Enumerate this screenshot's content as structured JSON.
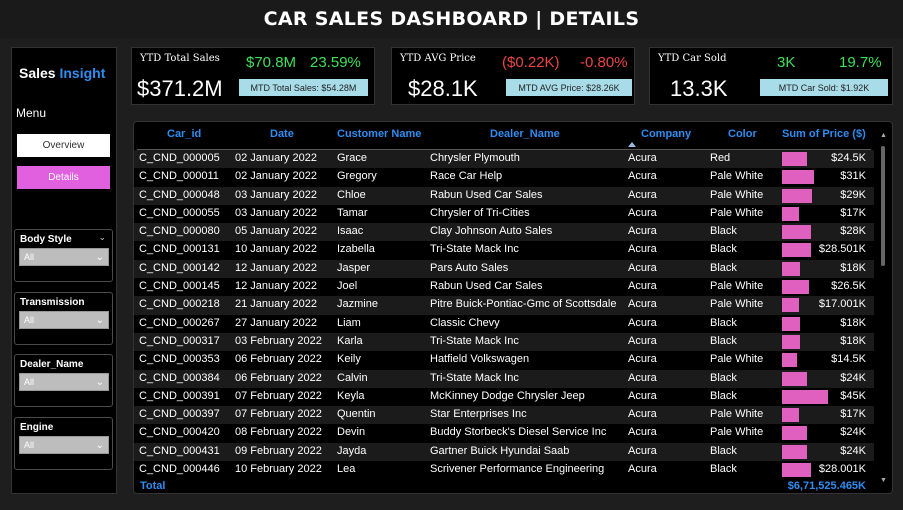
{
  "header": {
    "title": "CAR SALES DASHBOARD | DETAILS"
  },
  "sidebar": {
    "brand_part1": "Sales",
    "brand_part2": "Insight",
    "menu_label": "Menu",
    "overview_label": "Overview",
    "details_label": "Details",
    "slicers": [
      {
        "label": "Body Style",
        "value": "All"
      },
      {
        "label": "Transmission",
        "value": "All"
      },
      {
        "label": "Dealer_Name",
        "value": "All"
      },
      {
        "label": "Engine",
        "value": "All"
      }
    ]
  },
  "kpis": {
    "total_sales": {
      "title": "YTD Total Sales",
      "main": "$371.2M",
      "value": "$70.8M",
      "pct": "23.59%",
      "badge": "MTD Total Sales: $54.28M"
    },
    "avg_price": {
      "title": "YTD AVG Price",
      "main": "$28.1K",
      "value": "($0.22K)",
      "pct": "-0.80%",
      "badge": "MTD AVG Price: $28.26K"
    },
    "cars_sold": {
      "title": "YTD Car Sold",
      "main": "13.3K",
      "value": "3K",
      "pct": "19.7%",
      "badge": "MTD Car Sold: $1.92K"
    }
  },
  "colors": {
    "accent_blue": "#2f8cf0",
    "pink": "#e060c0",
    "positive": "#3fe05a",
    "negative": "#e84545",
    "badge_bg": "#a8dce8"
  },
  "table": {
    "headers": [
      "Car_id",
      "Date",
      "Customer Name",
      "Dealer_Name",
      "Company",
      "Color",
      "Sum of Price ($)"
    ],
    "rows": [
      {
        "car_id": "C_CND_000005",
        "date": "02 January 2022",
        "customer": "Grace",
        "dealer": "Chrysler Plymouth",
        "company": "Acura",
        "color": "Red",
        "price": "$24.5K",
        "price_value": 24500
      },
      {
        "car_id": "C_CND_000011",
        "date": "02 January 2022",
        "customer": "Gregory",
        "dealer": "Race Car Help",
        "company": "Acura",
        "color": "Pale White",
        "price": "$31K",
        "price_value": 31000
      },
      {
        "car_id": "C_CND_000048",
        "date": "03 January 2022",
        "customer": "Chloe",
        "dealer": "Rabun Used Car Sales",
        "company": "Acura",
        "color": "Pale White",
        "price": "$29K",
        "price_value": 29000
      },
      {
        "car_id": "C_CND_000055",
        "date": "03 January 2022",
        "customer": "Tamar",
        "dealer": "Chrysler of Tri-Cities",
        "company": "Acura",
        "color": "Pale White",
        "price": "$17K",
        "price_value": 17000
      },
      {
        "car_id": "C_CND_000080",
        "date": "05 January 2022",
        "customer": "Isaac",
        "dealer": "Clay Johnson Auto Sales",
        "company": "Acura",
        "color": "Black",
        "price": "$28K",
        "price_value": 28000
      },
      {
        "car_id": "C_CND_000131",
        "date": "10 January 2022",
        "customer": "Izabella",
        "dealer": "Tri-State Mack Inc",
        "company": "Acura",
        "color": "Black",
        "price": "$28.501K",
        "price_value": 28501
      },
      {
        "car_id": "C_CND_000142",
        "date": "12 January 2022",
        "customer": "Jasper",
        "dealer": "Pars Auto Sales",
        "company": "Acura",
        "color": "Black",
        "price": "$18K",
        "price_value": 18000
      },
      {
        "car_id": "C_CND_000145",
        "date": "12 January 2022",
        "customer": "Joel",
        "dealer": "Rabun Used Car Sales",
        "company": "Acura",
        "color": "Pale White",
        "price": "$26.5K",
        "price_value": 26500
      },
      {
        "car_id": "C_CND_000218",
        "date": "21 January 2022",
        "customer": "Jazmine",
        "dealer": "Pitre Buick-Pontiac-Gmc of Scottsdale",
        "company": "Acura",
        "color": "Pale White",
        "price": "$17.001K",
        "price_value": 17001
      },
      {
        "car_id": "C_CND_000267",
        "date": "27 January 2022",
        "customer": "Liam",
        "dealer": "Classic Chevy",
        "company": "Acura",
        "color": "Black",
        "price": "$18K",
        "price_value": 18000
      },
      {
        "car_id": "C_CND_000317",
        "date": "03 February 2022",
        "customer": "Karla",
        "dealer": "Tri-State Mack Inc",
        "company": "Acura",
        "color": "Black",
        "price": "$18K",
        "price_value": 18000
      },
      {
        "car_id": "C_CND_000353",
        "date": "06 February 2022",
        "customer": "Keily",
        "dealer": "Hatfield Volkswagen",
        "company": "Acura",
        "color": "Pale White",
        "price": "$14.5K",
        "price_value": 14500
      },
      {
        "car_id": "C_CND_000384",
        "date": "06 February 2022",
        "customer": "Calvin",
        "dealer": "Tri-State Mack Inc",
        "company": "Acura",
        "color": "Black",
        "price": "$24K",
        "price_value": 24000
      },
      {
        "car_id": "C_CND_000391",
        "date": "07 February 2022",
        "customer": "Keyla",
        "dealer": "McKinney Dodge Chrysler Jeep",
        "company": "Acura",
        "color": "Black",
        "price": "$45K",
        "price_value": 45000
      },
      {
        "car_id": "C_CND_000397",
        "date": "07 February 2022",
        "customer": "Quentin",
        "dealer": "Star Enterprises Inc",
        "company": "Acura",
        "color": "Pale White",
        "price": "$17K",
        "price_value": 17000
      },
      {
        "car_id": "C_CND_000420",
        "date": "08 February 2022",
        "customer": "Devin",
        "dealer": "Buddy Storbeck's Diesel Service Inc",
        "company": "Acura",
        "color": "Pale White",
        "price": "$24K",
        "price_value": 24000
      },
      {
        "car_id": "C_CND_000431",
        "date": "09 February 2022",
        "customer": "Jayda",
        "dealer": "Gartner Buick Hyundai Saab",
        "company": "Acura",
        "color": "Black",
        "price": "$24K",
        "price_value": 24000
      },
      {
        "car_id": "C_CND_000446",
        "date": "10 February 2022",
        "customer": "Lea",
        "dealer": "Scrivener Performance Engineering",
        "company": "Acura",
        "color": "Black",
        "price": "$28.001K",
        "price_value": 28001
      }
    ],
    "total_label": "Total",
    "total_value": "$6,71,525.465K"
  }
}
